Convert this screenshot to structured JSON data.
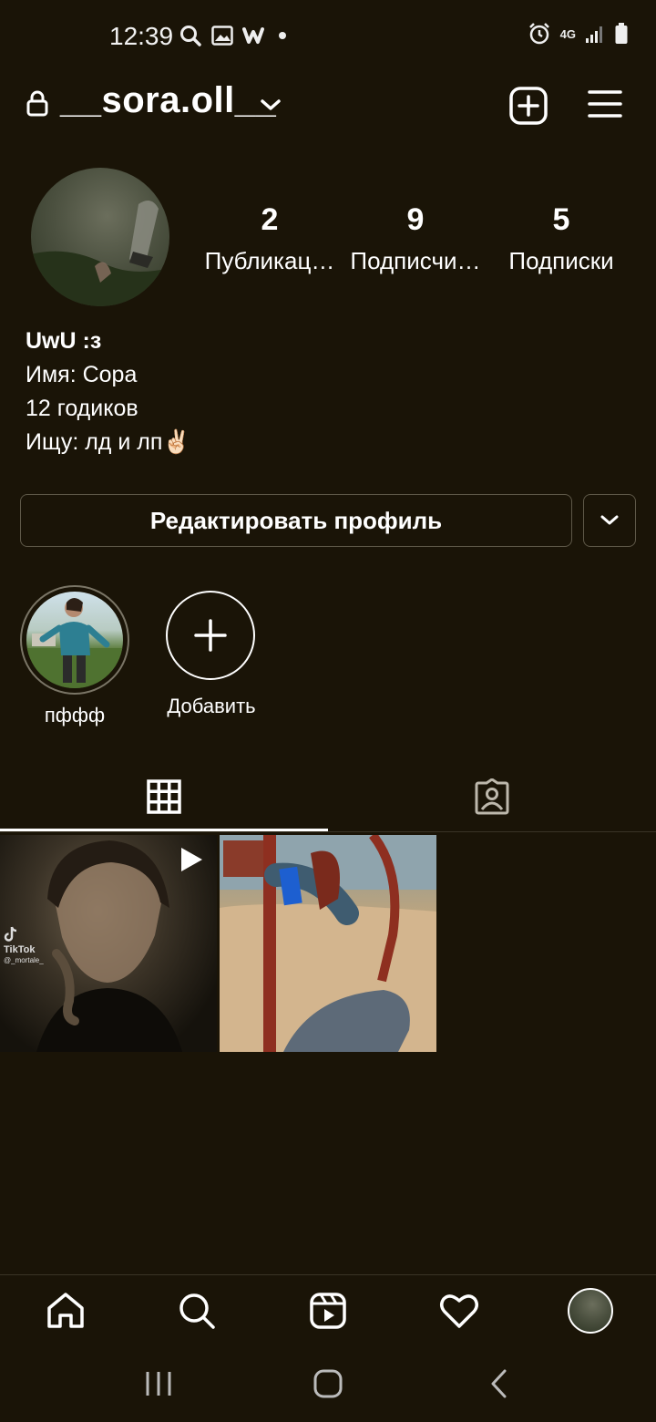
{
  "status_bar": {
    "time": "12:39",
    "network": "4G"
  },
  "header": {
    "username": "__sora.oll__"
  },
  "profile": {
    "stats": [
      {
        "count": "2",
        "label": "Публикац…"
      },
      {
        "count": "9",
        "label": "Подписчи…"
      },
      {
        "count": "5",
        "label": "Подписки"
      }
    ],
    "bio": {
      "name": "UwU :з",
      "lines": [
        "Имя: Сора",
        "12 годиков",
        "Ищу: лд и лп✌🏻"
      ]
    }
  },
  "actions": {
    "edit_profile_label": "Редактировать профиль"
  },
  "highlights": [
    {
      "label": "пффф"
    }
  ],
  "add_highlight_label": "Добавить",
  "tabs": [
    "grid",
    "tagged"
  ],
  "posts": [
    {
      "type": "reel",
      "watermark": "TikTok",
      "watermark_user": "@_mortale_"
    },
    {
      "type": "photo"
    }
  ],
  "bottom_nav": [
    "home",
    "search",
    "reels",
    "activity",
    "profile"
  ],
  "colors": {
    "background": "#1a1407",
    "text": "#ffffff",
    "border": "#5e5848"
  }
}
